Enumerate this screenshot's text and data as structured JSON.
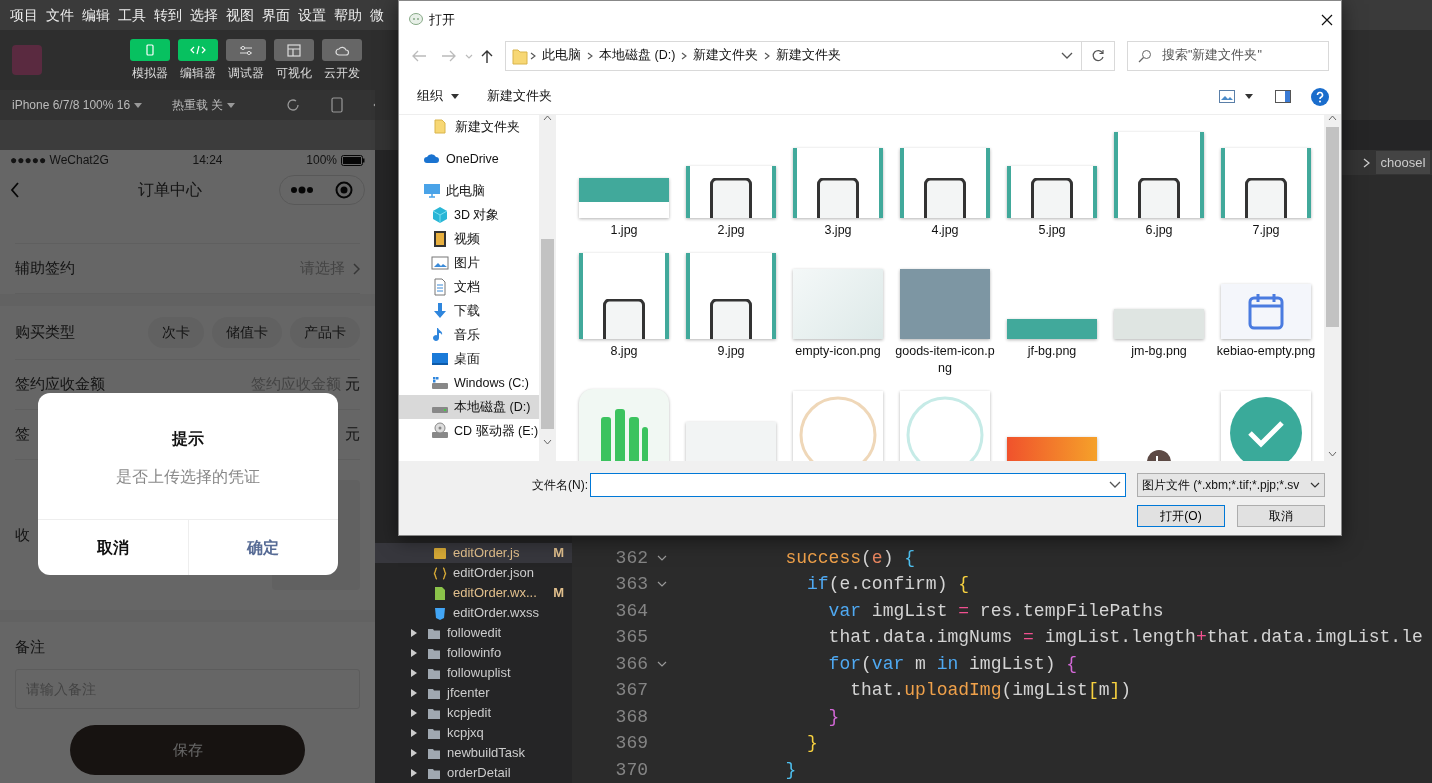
{
  "menu_bar": [
    "项目",
    "文件",
    "编辑",
    "工具",
    "转到",
    "选择",
    "视图",
    "界面",
    "设置",
    "帮助",
    "微"
  ],
  "toolbar": [
    {
      "label": "模拟器",
      "kind": "phone",
      "selected": true
    },
    {
      "label": "编辑器",
      "kind": "code",
      "selected": true
    },
    {
      "label": "调试器",
      "kind": "sliders",
      "selected": false
    },
    {
      "label": "可视化",
      "kind": "layout",
      "selected": false
    },
    {
      "label": "云开发",
      "kind": "cloud",
      "selected": false
    }
  ],
  "simulator_bar": {
    "device": "iPhone 6/7/8 100% 16",
    "hot_reload": "热重载 关"
  },
  "phone": {
    "carrier": "●●●●● WeChat2G",
    "time": "14:24",
    "battery": "100%",
    "title": "订单中心",
    "rows": [
      {
        "kind": "blank"
      },
      {
        "kind": "select",
        "label": "辅助签约",
        "value": "请选择"
      },
      {
        "kind": "gap"
      },
      {
        "kind": "chips",
        "label": "购买类型",
        "chips": [
          "次卡",
          "储值卡",
          "产品卡"
        ]
      },
      {
        "kind": "amount",
        "label": "签约应收金额",
        "placeholder": "签约应收金额",
        "unit": "元"
      },
      {
        "kind": "amount",
        "label": "签",
        "unit": "元"
      },
      {
        "kind": "upload",
        "label": "收"
      },
      {
        "kind": "gap"
      }
    ],
    "remark_label": "备注",
    "remark_placeholder": "请输入备注",
    "save": "保存",
    "modal": {
      "title": "提示",
      "message": "是否上传选择的凭证",
      "cancel": "取消",
      "confirm": "确定"
    }
  },
  "file_tree": [
    {
      "name": "editOrder.js",
      "kind": "js",
      "badge": "M",
      "selected": true
    },
    {
      "name": "editOrder.json",
      "kind": "json",
      "selected": false
    },
    {
      "name": "editOrder.wx...",
      "kind": "wxml",
      "badge": "M",
      "selected": false
    },
    {
      "name": "editOrder.wxss",
      "kind": "wxss",
      "selected": false
    },
    {
      "name": "followedit",
      "kind": "folder",
      "selected": false
    },
    {
      "name": "followinfo",
      "kind": "folder",
      "selected": false
    },
    {
      "name": "followuplist",
      "kind": "folder",
      "selected": false
    },
    {
      "name": "jfcenter",
      "kind": "folder",
      "selected": false
    },
    {
      "name": "kcpjedit",
      "kind": "folder",
      "selected": false
    },
    {
      "name": "kcpjxq",
      "kind": "folder",
      "selected": false
    },
    {
      "name": "newbuildTask",
      "kind": "folder",
      "selected": false
    },
    {
      "name": "orderDetail",
      "kind": "folder",
      "selected": false
    }
  ],
  "editor": {
    "breadcrumb": "chooseI",
    "lines": [
      {
        "number": "362",
        "fold": true,
        "tokens": [
          {
            "text": "        success",
            "kind": "fn"
          },
          {
            "text": "(",
            "kind": "pl"
          },
          {
            "text": "e",
            "kind": "param"
          },
          {
            "text": ") ",
            "kind": "pl"
          },
          {
            "text": "{",
            "kind": "bc"
          }
        ]
      },
      {
        "number": "363",
        "fold": true,
        "tokens": [
          {
            "text": "          if",
            "kind": "kw"
          },
          {
            "text": "(e.confirm) ",
            "kind": "pl"
          },
          {
            "text": "{",
            "kind": "by"
          }
        ]
      },
      {
        "number": "364",
        "fold": false,
        "tokens": [
          {
            "text": "            var",
            "kind": "kw"
          },
          {
            "text": " imgList ",
            "kind": "pl"
          },
          {
            "text": "=",
            "kind": "op"
          },
          {
            "text": " res.tempFilePaths",
            "kind": "pl"
          }
        ]
      },
      {
        "number": "365",
        "fold": false,
        "tokens": [
          {
            "text": "            that.data.imgNums ",
            "kind": "pl"
          },
          {
            "text": "=",
            "kind": "op"
          },
          {
            "text": " imgList.length",
            "kind": "pl"
          },
          {
            "text": "+",
            "kind": "op"
          },
          {
            "text": "that.data.imgList.le",
            "kind": "pl"
          }
        ]
      },
      {
        "number": "366",
        "fold": true,
        "tokens": [
          {
            "text": "            for",
            "kind": "kw"
          },
          {
            "text": "(",
            "kind": "pl"
          },
          {
            "text": "var",
            "kind": "kw"
          },
          {
            "text": " m ",
            "kind": "pl"
          },
          {
            "text": "in",
            "kind": "kw"
          },
          {
            "text": " imgList) ",
            "kind": "pl"
          },
          {
            "text": "{",
            "kind": "bm"
          }
        ]
      },
      {
        "number": "367",
        "fold": false,
        "tokens": [
          {
            "text": "              that.",
            "kind": "pl"
          },
          {
            "text": "uploadImg",
            "kind": "fn"
          },
          {
            "text": "(imgList",
            "kind": "pl"
          },
          {
            "text": "[",
            "kind": "by"
          },
          {
            "text": "m",
            "kind": "pl"
          },
          {
            "text": "]",
            "kind": "by"
          },
          {
            "text": ")",
            "kind": "pl"
          }
        ]
      },
      {
        "number": "368",
        "fold": false,
        "tokens": [
          {
            "text": "            }",
            "kind": "bm"
          }
        ]
      },
      {
        "number": "369",
        "fold": false,
        "tokens": [
          {
            "text": "          }",
            "kind": "by"
          }
        ]
      },
      {
        "number": "370",
        "fold": false,
        "tokens": [
          {
            "text": "        }",
            "kind": "bc"
          }
        ]
      }
    ]
  },
  "dialog": {
    "title": "打开",
    "path": [
      "此电脑",
      "本地磁盘 (D:)",
      "新建文件夹",
      "新建文件夹"
    ],
    "search_placeholder": "搜索\"新建文件夹\"",
    "organize": "组织",
    "new_folder": "新建文件夹",
    "nav": [
      {
        "label": "新建文件夹",
        "kind": "folder",
        "selected": false
      },
      {
        "label": "OneDrive",
        "kind": "cloud",
        "selected": false
      },
      {
        "label": "此电脑",
        "kind": "pc",
        "selected": false,
        "children": [
          {
            "label": "3D 对象",
            "kind": "cube",
            "selected": false
          },
          {
            "label": "视频",
            "kind": "video",
            "selected": false
          },
          {
            "label": "图片",
            "kind": "picture",
            "selected": false
          },
          {
            "label": "文档",
            "kind": "doc",
            "selected": false
          },
          {
            "label": "下载",
            "kind": "download",
            "selected": false
          },
          {
            "label": "音乐",
            "kind": "music",
            "selected": false
          },
          {
            "label": "桌面",
            "kind": "desktop",
            "selected": false
          },
          {
            "label": "Windows (C:)",
            "kind": "drive-win",
            "selected": false
          },
          {
            "label": "本地磁盘 (D:)",
            "kind": "drive",
            "selected": true
          },
          {
            "label": "CD 驱动器 (E:)",
            "kind": "cd",
            "selected": false
          }
        ]
      }
    ],
    "files": [
      {
        "name": "1.jpg",
        "kind": "banner"
      },
      {
        "name": "2.jpg",
        "kind": "guide-short"
      },
      {
        "name": "3.jpg",
        "kind": "guide"
      },
      {
        "name": "4.jpg",
        "kind": "guide"
      },
      {
        "name": "5.jpg",
        "kind": "guide-short"
      },
      {
        "name": "6.jpg",
        "kind": "guide-tall"
      },
      {
        "name": "7.jpg",
        "kind": "guide"
      },
      {
        "name": "8.jpg",
        "kind": "guide-tall"
      },
      {
        "name": "9.jpg",
        "kind": "guide-tall"
      },
      {
        "name": "empty-icon.png",
        "kind": "illustration"
      },
      {
        "name": "goods-item-icon.png",
        "kind": "photo"
      },
      {
        "name": "jf-bg.png",
        "kind": "strip"
      },
      {
        "name": "jm-bg.png",
        "kind": "strip-light"
      },
      {
        "name": "kebiao-empty.png",
        "kind": "calendar"
      },
      {
        "kind": "app-icon"
      },
      {
        "kind": "box"
      },
      {
        "kind": "stamp-orange"
      },
      {
        "kind": "stamp-teal"
      },
      {
        "kind": "promo"
      },
      {
        "kind": "clock"
      },
      {
        "kind": "check"
      }
    ],
    "filename_label": "文件名(N):",
    "filter": "图片文件 (*.xbm;*.tif;*.pjp;*.sv",
    "open": "打开(O)",
    "cancel": "取消"
  }
}
